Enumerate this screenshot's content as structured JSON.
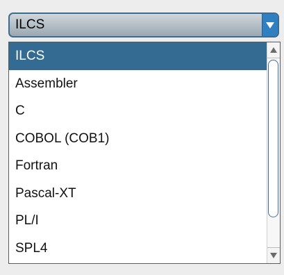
{
  "combo": {
    "selected_value": "ILCS",
    "arrow_icon": "triangle-down-icon",
    "accent_color": "#2f7fc1"
  },
  "list": {
    "items": [
      {
        "label": "ILCS",
        "selected": true
      },
      {
        "label": "Assembler",
        "selected": false
      },
      {
        "label": "C",
        "selected": false
      },
      {
        "label": "COBOL (COB1)",
        "selected": false
      },
      {
        "label": "Fortran",
        "selected": false
      },
      {
        "label": "Pascal-XT",
        "selected": false
      },
      {
        "label": "PL/I",
        "selected": false
      },
      {
        "label": "SPL4",
        "selected": false
      }
    ],
    "selection_color": "#336b93"
  },
  "scrollbar": {
    "up_icon": "triangle-up-icon",
    "down_icon": "triangle-down-icon",
    "thumb_start_fraction": 0.0,
    "thumb_size_fraction": 0.85
  }
}
